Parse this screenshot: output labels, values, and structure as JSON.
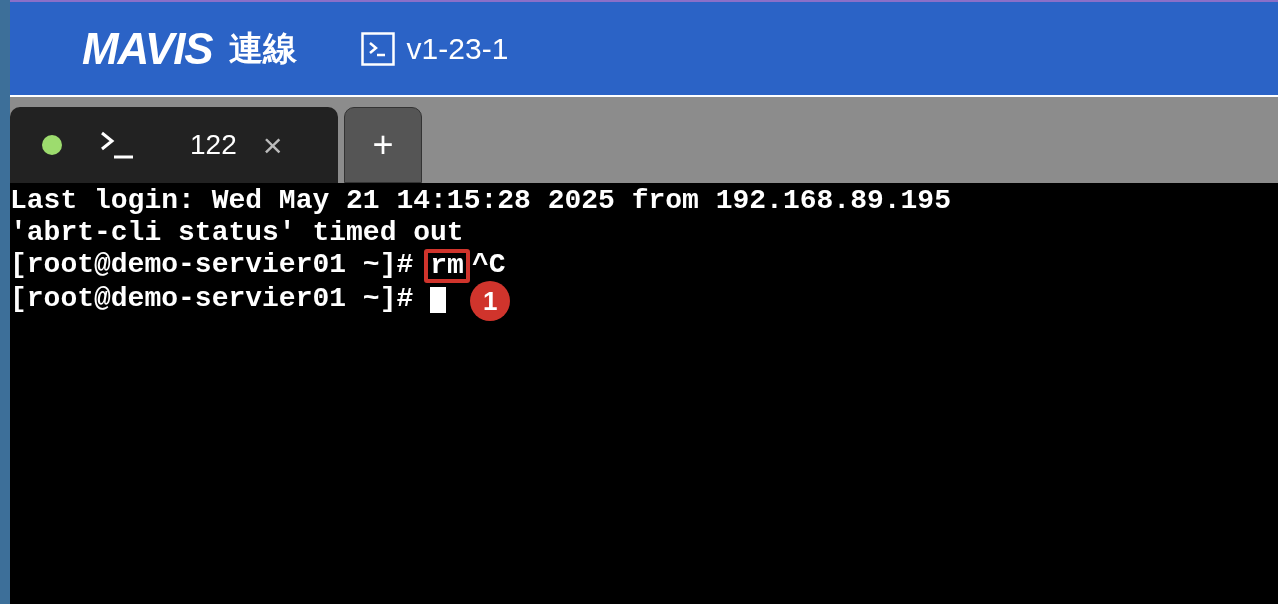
{
  "header": {
    "logo": "MAVIS",
    "title": "連線",
    "session": "v1-23-1"
  },
  "tabs": [
    {
      "label": "122",
      "selected": true,
      "color": "#9ddc6e",
      "close": "×"
    }
  ],
  "add_tab": "+",
  "terminal": {
    "lines": [
      {
        "kind": "text",
        "text": "Last login: Wed May 21 14:15:28 2025 from 192.168.89.195"
      },
      {
        "kind": "text",
        "text": "'abrt-cli status' timed out"
      },
      {
        "kind": "prompt",
        "prompt": "[root@demo-servier01 ~]#",
        "command": "rm",
        "suffix": "^C",
        "highlighted": true
      },
      {
        "kind": "prompt",
        "prompt": "[root@demo-servier01 ~]#",
        "cursor": true,
        "badge": "1"
      }
    ]
  }
}
